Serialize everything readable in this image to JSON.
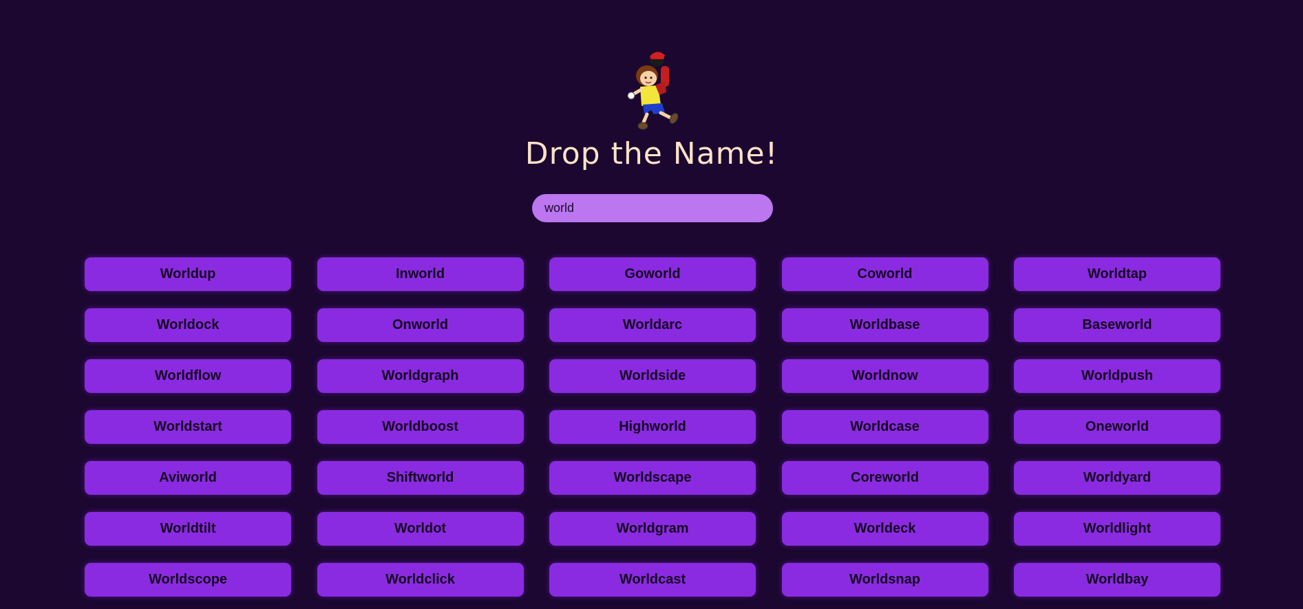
{
  "header": {
    "title": "Drop the Name!"
  },
  "search": {
    "value": "world",
    "placeholder": ""
  },
  "results": [
    "Worldup",
    "Inworld",
    "Goworld",
    "Coworld",
    "Worldtap",
    "Worldock",
    "Onworld",
    "Worldarc",
    "Worldbase",
    "Baseworld",
    "Worldflow",
    "Worldgraph",
    "Worldside",
    "Worldnow",
    "Worldpush",
    "Worldstart",
    "Worldboost",
    "Highworld",
    "Worldcase",
    "Oneworld",
    "Aviworld",
    "Shiftworld",
    "Worldscape",
    "Coreworld",
    "Worldyard",
    "Worldtilt",
    "Worldot",
    "Worldgram",
    "Worldeck",
    "Worldlight",
    "Worldscope",
    "Worldclick",
    "Worldcast",
    "Worldsnap",
    "Worldbay"
  ],
  "colors": {
    "background": "#1c0731",
    "title": "#fbe3c6",
    "search_bg": "#bc76f0",
    "button_bg": "#8a2be2",
    "button_text": "#15061f"
  }
}
